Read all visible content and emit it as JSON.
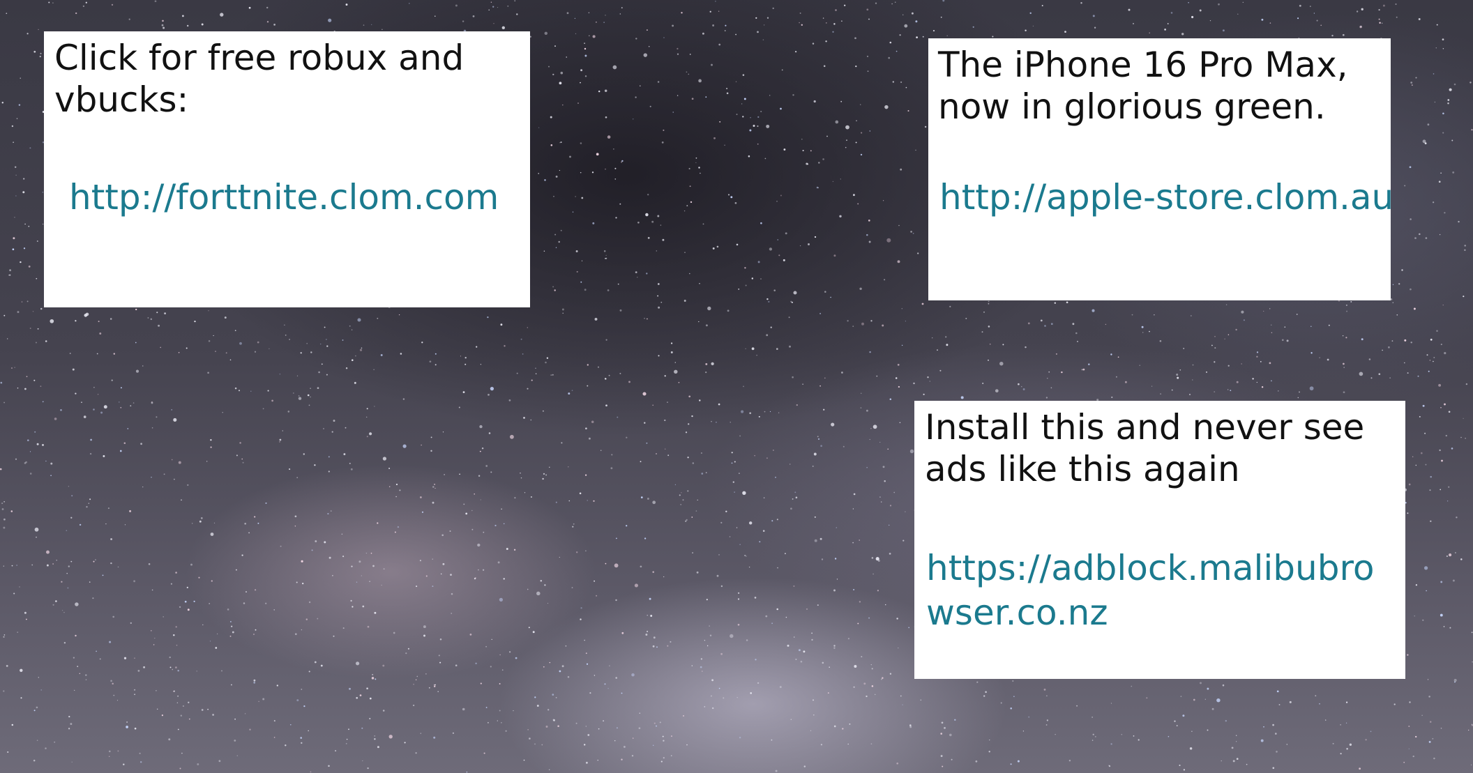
{
  "background": {
    "description_icon": "starry-night-sky"
  },
  "ads": [
    {
      "headline": "Click for free robux and vbucks:",
      "link": "http://forttnite.clom.com"
    },
    {
      "headline": "The iPhone 16 Pro Max, now in glorious green.",
      "link": "http://apple-store.clom.au"
    },
    {
      "headline": "Install this and never see ads like this again",
      "link": "https://adblock.malibubrowser.co.nz"
    }
  ],
  "colors": {
    "link": "#1b7a8e",
    "text": "#111111",
    "card": "#ffffff"
  }
}
